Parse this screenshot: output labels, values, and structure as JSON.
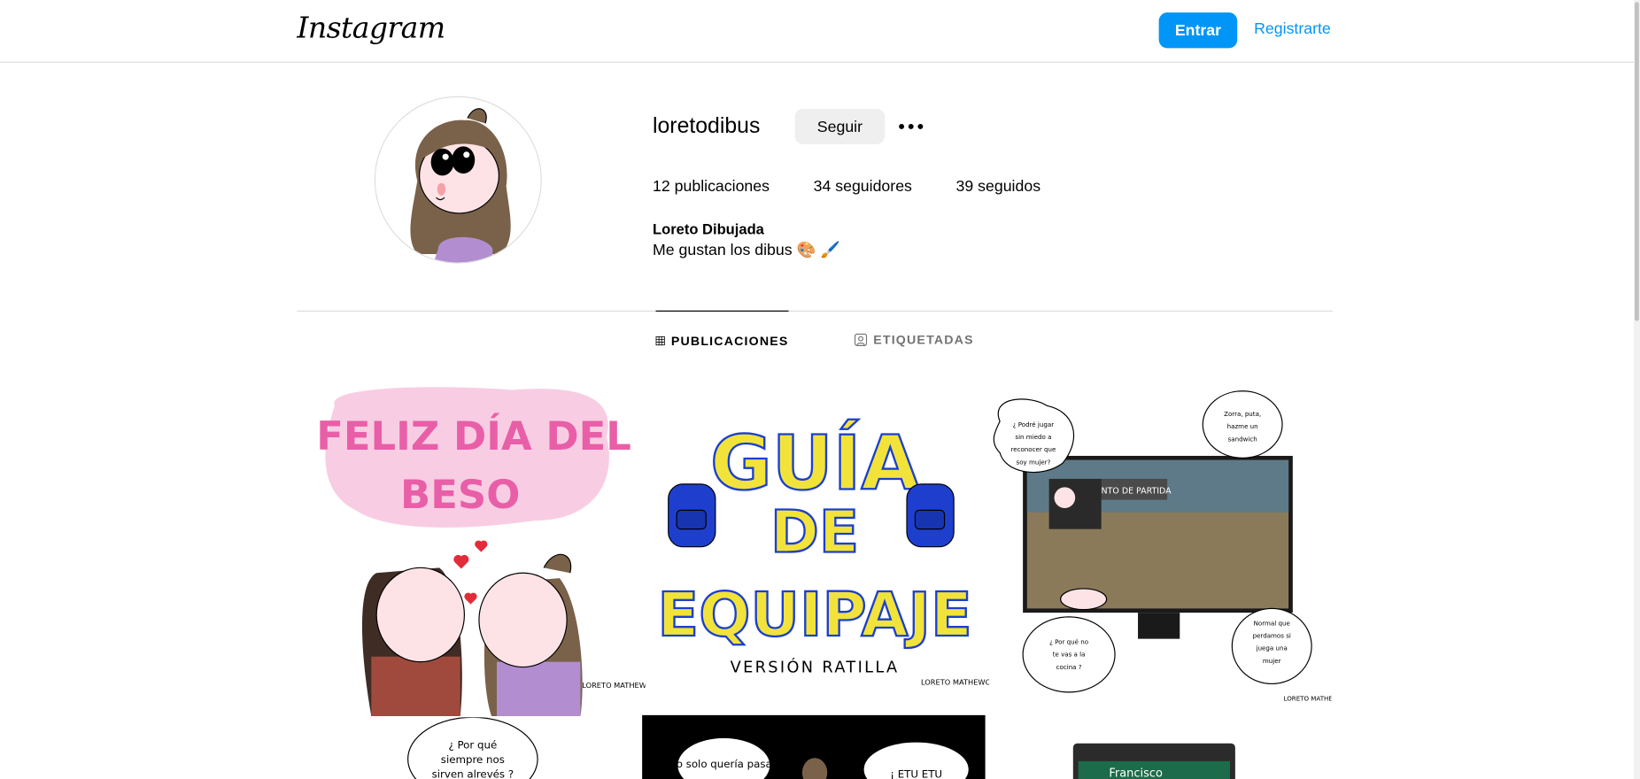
{
  "header": {
    "logo_text": "Instagram",
    "login_label": "Entrar",
    "signup_label": "Registrarte"
  },
  "profile": {
    "username": "loretodibus",
    "follow_label": "Seguir",
    "stats": {
      "posts": "12 publicaciones",
      "followers": "34 seguidores",
      "following": "39 seguidos"
    },
    "full_name": "Loreto Dibujada",
    "bio": "Me gustan los dibus 🎨 🖌️"
  },
  "tabs": [
    {
      "label": "PUBLICACIONES",
      "active": true
    },
    {
      "label": "ETIQUETADAS",
      "active": false
    }
  ],
  "posts": [
    {
      "text": [
        "FELIZ DÍA DEL",
        "BESO"
      ],
      "signature": "LORETO MATHEWO"
    },
    {
      "text": [
        "GUÍA",
        "DE",
        "EQUIPAJE",
        "VERSIÓN RATILLA"
      ],
      "signature": "LORETO MATHEWO"
    },
    {
      "bubbles": [
        "¿ Podré jugar sin miedo a reconocer que soy mujer?",
        "Zorra, puta, hazme un sandwich",
        "¿ Por qué no te vas a la cocina ?",
        "Normal que perdamos si juega una mujer"
      ],
      "screen_text": "PUNTO DE PARTIDA",
      "signature": "LORETO MATHEWO"
    },
    {
      "bubbles": [
        "¿ Por qué siempre nos sirven alrevés ?"
      ]
    },
    {
      "bubbles": [
        "Yo solo quería pasar",
        "¡ ETU ETU"
      ]
    },
    {
      "bubbles": [
        "Francisco"
      ]
    }
  ],
  "colors": {
    "accent": "#0095f6",
    "border": "#dbdbdb",
    "secondary_text": "#737373",
    "button_gray": "#efefef"
  }
}
